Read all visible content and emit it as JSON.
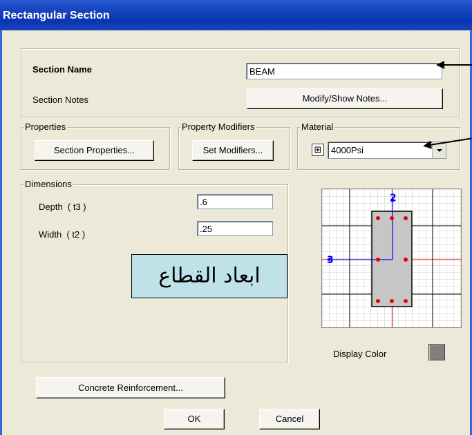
{
  "window": {
    "title": "Rectangular Section"
  },
  "section": {
    "name_label": "Section Name",
    "name_value": "BEAM",
    "notes_label": "Section Notes",
    "notes_button": "Modify/Show Notes..."
  },
  "properties": {
    "legend": "Properties",
    "button": "Section Properties..."
  },
  "modifiers": {
    "legend": "Property Modifiers",
    "button": "Set Modifiers..."
  },
  "material": {
    "legend": "Material",
    "expand_glyph": "⊞",
    "value": "4000Psi"
  },
  "dimensions": {
    "legend": "Dimensions",
    "depth_label": "Depth  ( t3 )",
    "depth_value": ".6",
    "width_label": "Width  ( t2 )",
    "width_value": ".25"
  },
  "annotation": {
    "text": "ابعاد القطاع"
  },
  "preview": {
    "axis2_label": "2",
    "axis3_label": "3"
  },
  "display_color": {
    "label": "Display Color",
    "color": "#808080"
  },
  "buttons": {
    "reinforcement": "Concrete Reinforcement...",
    "ok": "OK",
    "cancel": "Cancel"
  }
}
